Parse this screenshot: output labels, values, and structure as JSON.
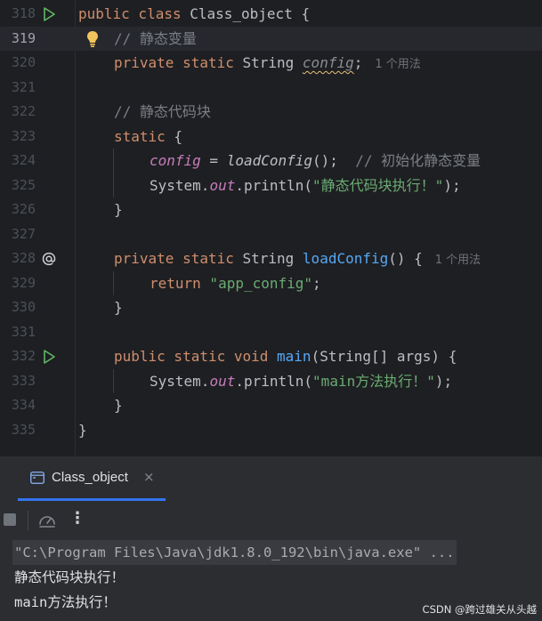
{
  "editor": {
    "lines": [
      {
        "num": "318"
      },
      {
        "num": "319"
      },
      {
        "num": "320"
      },
      {
        "num": "321"
      },
      {
        "num": "322"
      },
      {
        "num": "323"
      },
      {
        "num": "324"
      },
      {
        "num": "325"
      },
      {
        "num": "326"
      },
      {
        "num": "327"
      },
      {
        "num": "328"
      },
      {
        "num": "329"
      },
      {
        "num": "330"
      },
      {
        "num": "331"
      },
      {
        "num": "332"
      },
      {
        "num": "333"
      },
      {
        "num": "334"
      },
      {
        "num": "335"
      }
    ],
    "tokens": {
      "l318_kw": "public class",
      "l318_name": " Class_object {",
      "l319_comment": "// 静态变量",
      "l320_kw": "private static",
      "l320_type": " String ",
      "l320_field": "config",
      "l320_semi": ";",
      "l320_hint": "1 个用法",
      "l322_comment": "// 静态代码块",
      "l323_kw": "static",
      "l323_brace": " {",
      "l324_field": "config",
      "l324_eq": " = ",
      "l324_call": "loadConfig",
      "l324_rest": "();  ",
      "l324_comment": "// 初始化静态变量",
      "l325_sys": "System.",
      "l325_out": "out",
      "l325_print": ".println(",
      "l325_str": "\"静态代码块执行！\"",
      "l325_end": ");",
      "l326_brace": "}",
      "l328_kw": "private static",
      "l328_type": " String ",
      "l328_fn": "loadConfig",
      "l328_rest": "() {",
      "l328_hint": "1 个用法",
      "l329_kw": "return",
      "l329_str": " \"app_config\"",
      "l329_end": ";",
      "l330_brace": "}",
      "l332_kw": "public static void",
      "l332_fn": " main",
      "l332_rest": "(String[] args) {",
      "l333_sys": "System.",
      "l333_out": "out",
      "l333_print": ".println(",
      "l333_str": "\"main方法执行！\"",
      "l333_end": ");",
      "l334_brace": "}",
      "l335_brace": "}"
    },
    "colors": {
      "keyword": "#cf8e6d",
      "string": "#6aab73",
      "function": "#56a8f5",
      "static_field": "#c77dbb",
      "comment": "#7a7e85",
      "run_gutter": "#5fb865"
    }
  },
  "run_panel": {
    "tab_label": "Class_object",
    "tab_close": "×",
    "toolbar_more": "⋮",
    "console": {
      "command": "\"C:\\Program Files\\Java\\jdk1.8.0_192\\bin\\java.exe\" ...",
      "output": [
        "静态代码块执行！",
        "main方法执行！"
      ]
    },
    "accent": "#3574f0"
  },
  "watermark": "CSDN @跨过雄关从头越"
}
